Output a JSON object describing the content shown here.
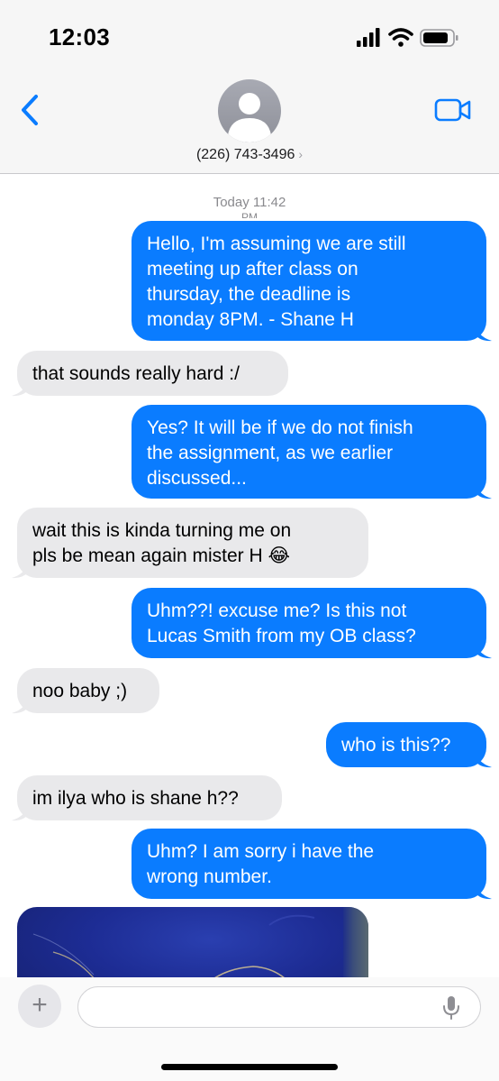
{
  "status_bar": {
    "time": "12:03",
    "signal_icon": "cellular-signal-icon",
    "wifi_icon": "wifi-icon",
    "battery_icon": "battery-icon"
  },
  "header": {
    "back_icon": "chevron-left-icon",
    "avatar_icon": "person-placeholder-icon",
    "contact_number": "(226) 743-3496",
    "contact_chevron": "›",
    "video_icon": "video-camera-icon"
  },
  "conversation": {
    "timestamp": "Today 11:42",
    "timestamp_sub": "PM",
    "messages": [
      {
        "direction": "outgoing",
        "text": "Hello, I'm assuming we are still\nmeeting up after class on\nthursday, the deadline is\nmonday 8PM. - Shane H"
      },
      {
        "direction": "incoming",
        "text": "that sounds really hard :/"
      },
      {
        "direction": "outgoing",
        "text": "Yes? It will be if we do not finish\nthe assignment, as we earlier\ndiscussed..."
      },
      {
        "direction": "incoming",
        "text": "wait this is kinda turning me on\npls be mean again mister H 😂"
      },
      {
        "direction": "outgoing",
        "text": "Uhm??! excuse me? Is this not\nLucas Smith from my OB class?"
      },
      {
        "direction": "incoming",
        "text": "noo baby ;)"
      },
      {
        "direction": "outgoing",
        "text": "who is this??"
      },
      {
        "direction": "incoming",
        "text": "im ilya who is shane h??"
      },
      {
        "direction": "outgoing",
        "text": "Uhm? I am sorry i have the\nwrong number."
      }
    ],
    "photo_message": {
      "direction": "incoming",
      "description_icon": "photo-attachment"
    }
  },
  "input_bar": {
    "plus_label": "+",
    "message_placeholder": "",
    "mic_icon": "microphone-icon"
  },
  "colors": {
    "outgoing_bubble": "#0a7cff",
    "incoming_bubble": "#e9e9eb",
    "accent": "#0a7cff"
  }
}
